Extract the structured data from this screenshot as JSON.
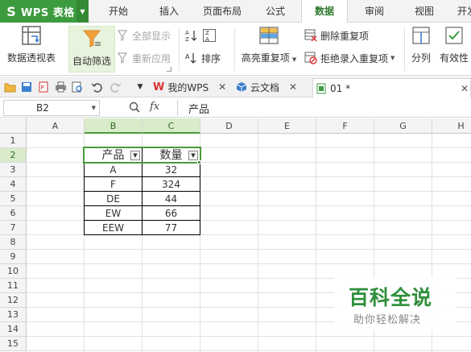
{
  "app": {
    "name": "WPS 表格",
    "logo_glyph": "S",
    "brand_color": "#3d9b3f"
  },
  "menu": {
    "tabs": [
      "开始",
      "插入",
      "页面布局",
      "公式",
      "数据",
      "审阅",
      "视图",
      "开发"
    ],
    "active": "数据"
  },
  "ribbon": {
    "pivot": "数据透视表",
    "autofilter": "自动筛选",
    "show_all": "全部显示",
    "reapply": "重新应用",
    "sort": "排序",
    "highlight_dup": "高亮重复项",
    "remove_dup": "删除重复项",
    "reject_dup": "拒绝录入重复项",
    "split": "分列",
    "validity": "有效性"
  },
  "doc_tabs": [
    {
      "label": "我的WPS",
      "icon": "wps-logo-icon",
      "closable": true
    },
    {
      "label": "云文档",
      "icon": "cloud-doc-icon",
      "closable": true
    },
    {
      "label": "01 *",
      "icon": "sheet-file-icon",
      "closable": true,
      "active": true
    }
  ],
  "formula_bar": {
    "cell_ref": "B2",
    "fx": "fx",
    "value": "产品"
  },
  "grid": {
    "columns": [
      "A",
      "B",
      "C",
      "D",
      "E",
      "F",
      "G",
      "H"
    ],
    "rows": [
      "1",
      "2",
      "3",
      "4",
      "5",
      "6",
      "7",
      "8",
      "9",
      "10",
      "11",
      "12",
      "13",
      "14",
      "15"
    ],
    "selected_cell": "B2"
  },
  "table": {
    "headers": [
      "产品",
      "数量"
    ],
    "rows": [
      [
        "A",
        "32"
      ],
      [
        "F",
        "324"
      ],
      [
        "DE",
        "44"
      ],
      [
        "EW",
        "66"
      ],
      [
        "EEW",
        "77"
      ]
    ]
  },
  "watermark": {
    "title": "百科全说",
    "subtitle": "助你轻松解决"
  }
}
